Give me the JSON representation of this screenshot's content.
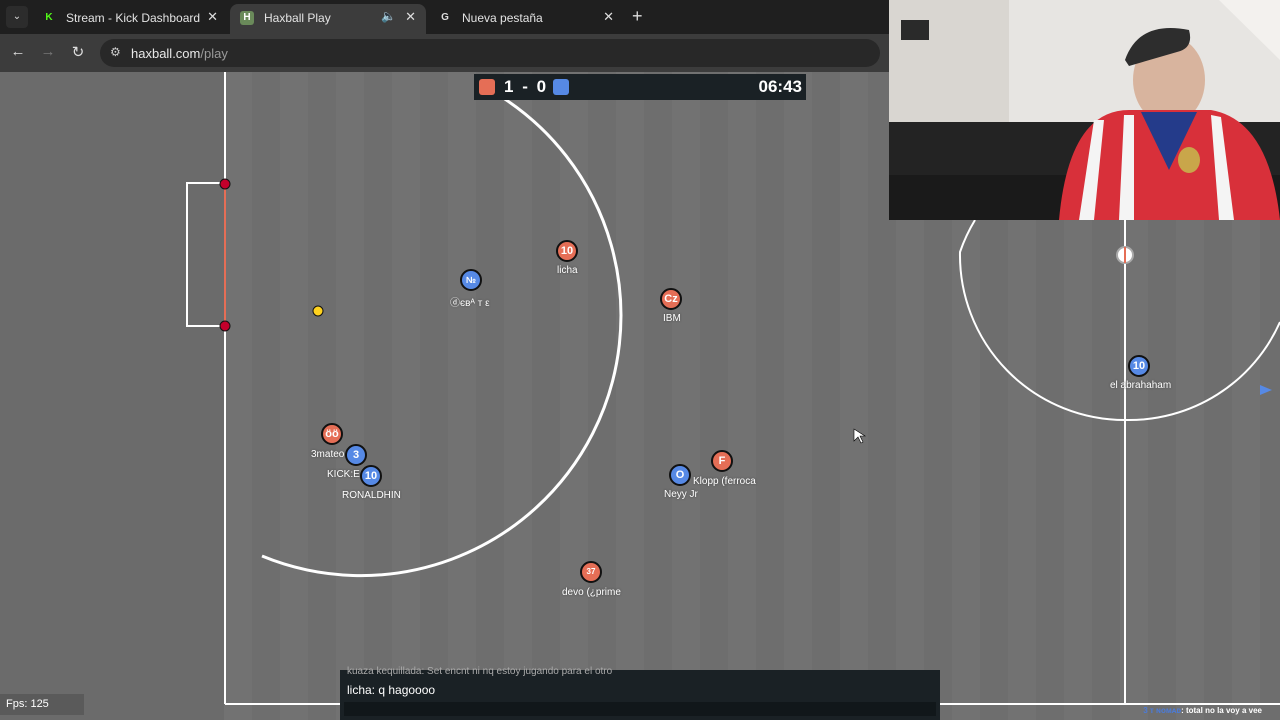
{
  "browser": {
    "tabs": [
      {
        "title": "Stream - Kick Dashboard",
        "favicon": "K",
        "active": false
      },
      {
        "title": "Haxball Play",
        "favicon": "H",
        "active": true
      },
      {
        "title": "Nueva pestaña",
        "favicon": "G",
        "active": false
      }
    ],
    "url_host": "haxball.com",
    "url_path": "/play"
  },
  "scoreboard": {
    "red_score": "1",
    "separator": "-",
    "blue_score": "0",
    "clock": "06:43",
    "red_color": "#e56e56",
    "blue_color": "#5689e5"
  },
  "players": [
    {
      "name": "licha",
      "avatar": "10",
      "team": "red"
    },
    {
      "name": "ⓓєвᴬ т ε",
      "avatar": "№",
      "team": "blue"
    },
    {
      "name": "IBM",
      "avatar": "Cz",
      "team": "red"
    },
    {
      "name": "el abrahaham",
      "avatar": "10",
      "team": "blue"
    },
    {
      "name": "3mateo",
      "avatar": "öö",
      "team": "red"
    },
    {
      "name": "KICK:E",
      "avatar": "3",
      "team": "blue"
    },
    {
      "name": "RONALDHIN",
      "avatar": "10",
      "team": "blue"
    },
    {
      "name": "Neyy Jr",
      "avatar": "O",
      "team": "blue"
    },
    {
      "name": "Klopp (ferroca",
      "avatar": "F",
      "team": "red"
    },
    {
      "name": "devo (¿prime",
      "avatar": "37",
      "team": "red"
    }
  ],
  "chat": {
    "previous_line": "kuaza kequillada: Set encnt ni nq estoy jugando para el otro",
    "last_line": "licha: q hagoooo"
  },
  "fps": "Fps: 125",
  "ticker": {
    "who": "3 ᴛ ɴᴏᴍᴀᴅ",
    "text": ": total no la voy a vee"
  },
  "icons": {
    "tab_search": "chevron-down-icon",
    "back": "arrow-left-icon",
    "forward": "arrow-right-icon",
    "reload": "reload-icon",
    "site_info": "tune-icon",
    "audio": "speaker-icon",
    "close": "close-icon",
    "new_tab": "plus-icon"
  }
}
